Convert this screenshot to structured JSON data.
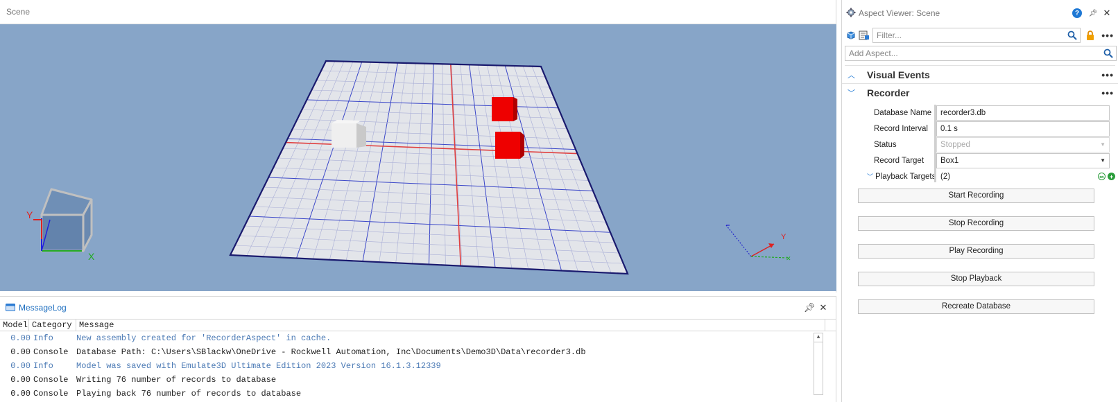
{
  "scene": {
    "title": "Scene",
    "axis_labels": {
      "y": "Y",
      "x": "X",
      "gizmo_y": "Y"
    }
  },
  "message_log": {
    "title": "MessageLog",
    "columns": [
      "Model",
      "Category",
      "Message"
    ],
    "rows": [
      {
        "time": "0.00",
        "category": "Info",
        "message": "New assembly created for 'RecorderAspect' in cache."
      },
      {
        "time": "0.00",
        "category": "Console",
        "message": "Database Path: C:\\Users\\SBlackw\\OneDrive - Rockwell Automation, Inc\\Documents\\Demo3D\\Data\\recorder3.db"
      },
      {
        "time": "0.00",
        "category": "Info",
        "message": "Model was saved with Emulate3D Ultimate Edition 2023 Version 16.1.3.12339"
      },
      {
        "time": "0.00",
        "category": "Console",
        "message": "Writing 76 number of records to database"
      },
      {
        "time": "0.00",
        "category": "Console",
        "message": "Playing back 76 number of records to database"
      }
    ]
  },
  "aspect_viewer": {
    "title": "Aspect Viewer: Scene",
    "help_label": "?",
    "filter_placeholder": "Filter...",
    "add_aspect_placeholder": "Add Aspect...",
    "sections": {
      "visual_events": "Visual Events",
      "recorder": "Recorder"
    },
    "properties": {
      "database_name_label": "Database Name",
      "database_name_value": "recorder3.db",
      "record_interval_label": "Record Interval",
      "record_interval_value": "0.1 s",
      "status_label": "Status",
      "status_value": "Stopped",
      "record_target_label": "Record Target",
      "record_target_value": "Box1",
      "playback_targets_label": "Playback Targets",
      "playback_targets_value": "(2)"
    },
    "buttons": {
      "start_recording": "Start Recording",
      "stop_recording": "Stop Recording",
      "play_recording": "Play Recording",
      "stop_playback": "Stop Playback",
      "recreate_database": "Recreate Database"
    }
  },
  "colors": {
    "viewport_bg": "#87a5c8",
    "accent_blue": "#1e78d4",
    "box_red": "#ee0000",
    "info_text": "#4b7ab5"
  },
  "icons": [
    "gear-icon",
    "help-icon",
    "pin-icon",
    "close-icon",
    "search-icon",
    "lock-icon",
    "more-icon",
    "chevron-up-icon",
    "chevron-down-icon",
    "link-icon",
    "add-icon",
    "messagelog-icon",
    "cube-icon",
    "notepad-icon"
  ]
}
